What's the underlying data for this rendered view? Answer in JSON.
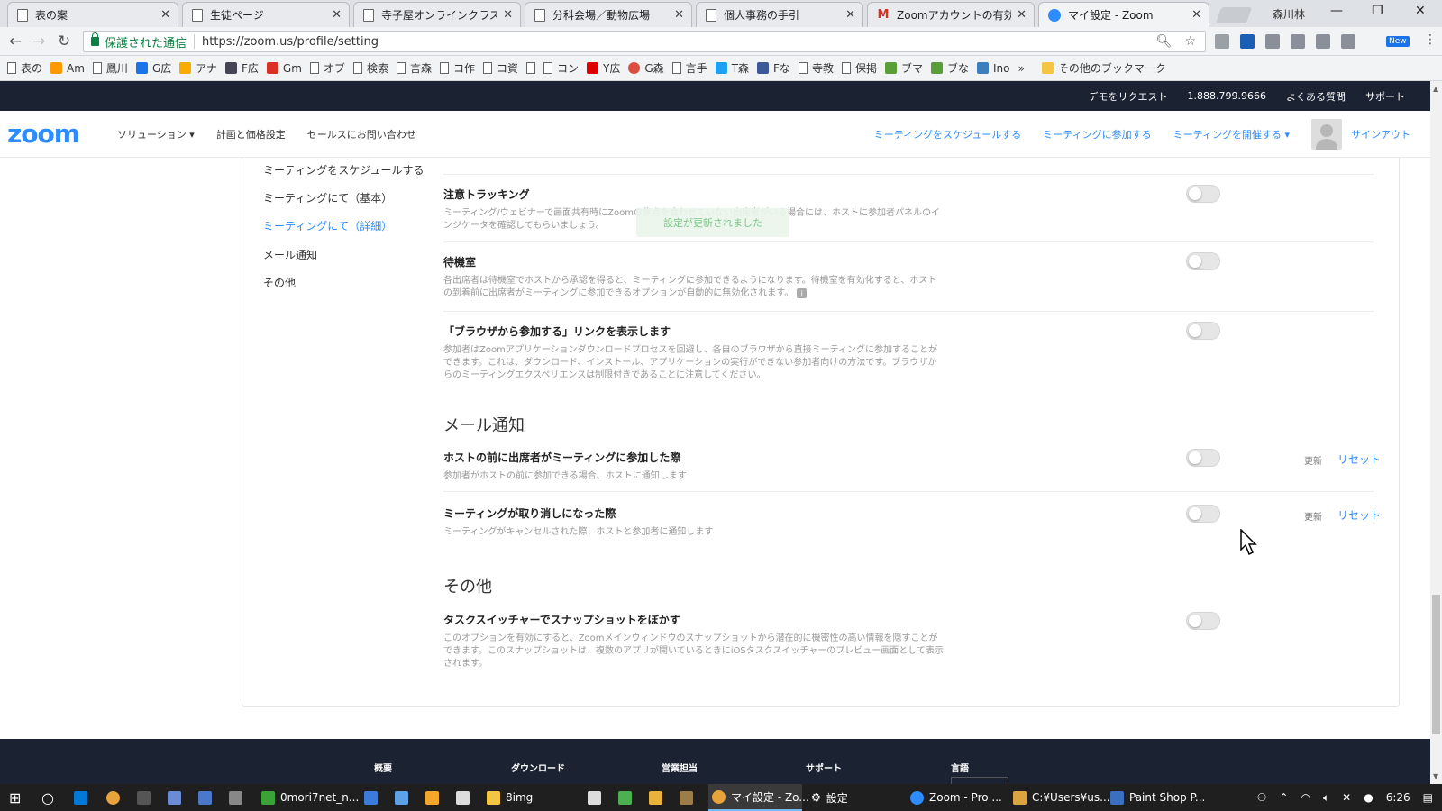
{
  "browser": {
    "tabs": [
      {
        "label": "表の案",
        "icon": "page"
      },
      {
        "label": "生徒ページ",
        "icon": "page"
      },
      {
        "label": "寺子屋オンラインクラス一覧",
        "icon": "page"
      },
      {
        "label": "分科会場／動物広場",
        "icon": "page"
      },
      {
        "label": "個人事務の手引",
        "icon": "page"
      },
      {
        "label": "Zoomアカウントの有効化 -",
        "icon": "gmail"
      },
      {
        "label": "マイ設定 - Zoom",
        "icon": "zoom"
      }
    ],
    "profile_name": "森川林",
    "secure_label": "保護された通信",
    "url": "https://zoom.us/profile/setting",
    "new_badge": "New",
    "bookmarks": [
      "表の",
      "Am",
      "鳳川",
      "G広",
      "アナ",
      "F広",
      "Gm",
      "オブ",
      "検索",
      "言森",
      "コ作",
      "コ資",
      "",
      "コン",
      "Y広",
      "G森",
      "言手",
      "T森",
      "Fな",
      "寺教",
      "保掲",
      "ブマ",
      "ブな",
      "Ino"
    ],
    "bookmarks_more": "»",
    "other_bookmarks": "その他のブックマーク"
  },
  "zoom": {
    "topbar": {
      "demo": "デモをリクエスト",
      "phone": "1.888.799.9666",
      "faq": "よくある質問",
      "support": "サポート"
    },
    "logo": "zoom",
    "nav": {
      "solutions": "ソリューション ▾",
      "pricing": "計画と価格設定",
      "contact": "セールスにお問い合わせ",
      "schedule": "ミーティングをスケジュールする",
      "join": "ミーティングに参加する",
      "host": "ミーティングを開催する ▾",
      "signout": "サインアウト"
    },
    "sidebar": [
      {
        "label": "ミーティングをスケジュールする",
        "active": false
      },
      {
        "label": "ミーティングにて（基本）",
        "active": false
      },
      {
        "label": "ミーティングにて（詳細）",
        "active": true
      },
      {
        "label": "メール通知",
        "active": false
      },
      {
        "label": "その他",
        "active": false
      }
    ],
    "toast_text": "設定が更新されました",
    "settings_meeting": [
      {
        "title": "注意トラッキング",
        "desc": "ミーティング/ウェビナーで画面共有時にZoomの焦点を合わせていない出席者がいる場合には、ホストに参加者パネルのインジケータを確認してもらいましょう。",
        "enabled": false
      },
      {
        "title": "待機室",
        "desc": "各出席者は待機室でホストから承認を得ると、ミーティングに参加できるようになります。待機室を有効化すると、ホストの到着前に出席者がミーティングに参加できるオプションが自動的に無効化されます。",
        "enabled": false
      },
      {
        "title": "「ブラウザから参加する」リンクを表示します",
        "desc": "参加者はZoomアプリケーションダウンロードプロセスを回避し、各自のブラウザから直接ミーティングに参加することができます。これは、ダウンロード、インストール、アプリケーションの実行ができない参加者向けの方法です。ブラウザからのミーティングエクスペリエンスは制限付きであることに注意してください。",
        "enabled": false
      }
    ],
    "section_email": "メール通知",
    "settings_email": [
      {
        "title": "ホストの前に出席者がミーティングに参加した際",
        "desc": "参加者がホストの前に参加できる場合、ホストに通知します",
        "enabled": false,
        "update": "更新",
        "reset": "リセット"
      },
      {
        "title": "ミーティングが取り消しになった際",
        "desc": "ミーティングがキャンセルされた際、ホストと参加者に通知します",
        "enabled": false,
        "update": "更新",
        "reset": "リセット"
      }
    ],
    "section_other": "その他",
    "settings_other": [
      {
        "title": "タスクスイッチャーでスナップショットをぼかす",
        "desc": "このオプションを有効にすると、Zoomメインウィンドウのスナップショットから潜在的に機密性の高い情報を隠すことができます。このスナップショットは、複数のアプリが開いているときにiOSタスクスイッチャーのプレビュー画面として表示されます。",
        "enabled": false
      }
    ],
    "footer": [
      "概要",
      "ダウンロード",
      "営業担当",
      "サポート",
      "言語"
    ]
  },
  "taskbar": {
    "items": [
      "0mori7net_n...",
      "8img",
      "マイ設定 - Zo...",
      "設定",
      "Zoom - Pro ...",
      "C:¥Users¥us...",
      "Paint Shop P..."
    ],
    "clock": "6:26"
  },
  "colors": {
    "zoom_blue": "#2d8cff",
    "zoom_dark": "#1b2231",
    "secure_green": "#0b8043"
  }
}
